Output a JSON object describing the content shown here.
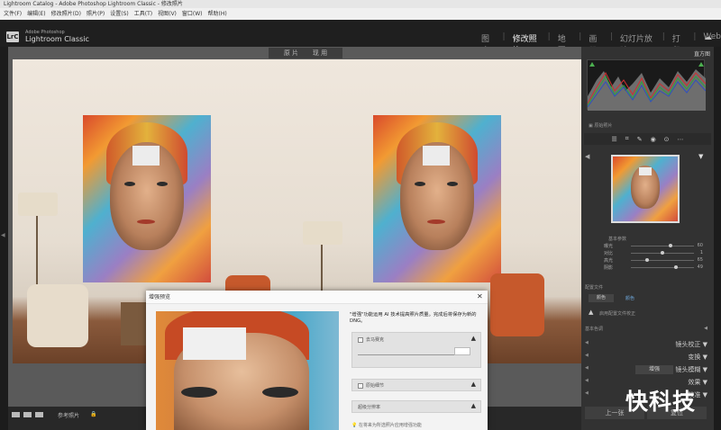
{
  "window": {
    "title": "Lightroom Catalog - Adobe Photoshop Lightroom Classic - 修改照片"
  },
  "menu": {
    "items": [
      "文件(F)",
      "编辑(E)",
      "修改照片(D)",
      "照片(P)",
      "设置(S)",
      "工具(T)",
      "视图(V)",
      "窗口(W)",
      "帮助(H)"
    ]
  },
  "identity": {
    "badge": "LrC",
    "brand_small": "Adobe Photoshop",
    "brand": "Lightroom Classic",
    "modules": [
      "图库",
      "修改照片",
      "地图",
      "画册",
      "幻灯片放映",
      "打印",
      "Web"
    ],
    "active_module": "修改照片"
  },
  "viewer": {
    "before_label": "原 片",
    "after_label": "现 用"
  },
  "filmstrip": {
    "label": "参考照片",
    "icons": [
      "view-grid-icon",
      "view-compare-icon",
      "view-yx-icon"
    ]
  },
  "right_panel": {
    "histogram_title": "直方图",
    "histogram_info": "▣ 原始照片",
    "tools": [
      "edit-sliders-icon",
      "crop-icon",
      "heal-icon",
      "mask-icon",
      "redeye-icon",
      "more-icon"
    ],
    "slider_section": "基本参数",
    "sliders": [
      {
        "label": "曝光",
        "value": "60",
        "pos": 0.63
      },
      {
        "label": "对比",
        "value": "1",
        "pos": 0.5
      },
      {
        "label": "高光",
        "value": "65",
        "pos": 0.25
      },
      {
        "label": "阴影",
        "value": "49",
        "pos": 0.72
      }
    ],
    "profile_row": "配置文件",
    "profile_value": "颜色",
    "profile_note": "颜色",
    "profile_warn": "启用配置文件校正",
    "collapse_label": "基本色调",
    "panels": [
      "镜头校正",
      "变换",
      "镜头模糊",
      "效果",
      "校准"
    ],
    "lens_blur_badge": "增强",
    "prev_button": "上一张",
    "reset_button": "复位"
  },
  "dialog": {
    "title": "增强预览",
    "close": "✕",
    "description": "\"增强\"功能运用 AI 技术提高照片质量。完成后将保存为新的 DNG。",
    "options": [
      {
        "label": "去马赛克",
        "checked": true
      },
      {
        "label": "原始细节",
        "checked": false
      },
      {
        "label": "超级分辨率",
        "checked": false
      }
    ],
    "footer": "在将来为所选照片应用增强功能"
  },
  "colors": {
    "accent": "#ffffff",
    "panel_bg": "#323232",
    "viewer_bg": "#5a5a5a",
    "dialog_bg": "#f3f3f3"
  },
  "watermark": "快科技"
}
